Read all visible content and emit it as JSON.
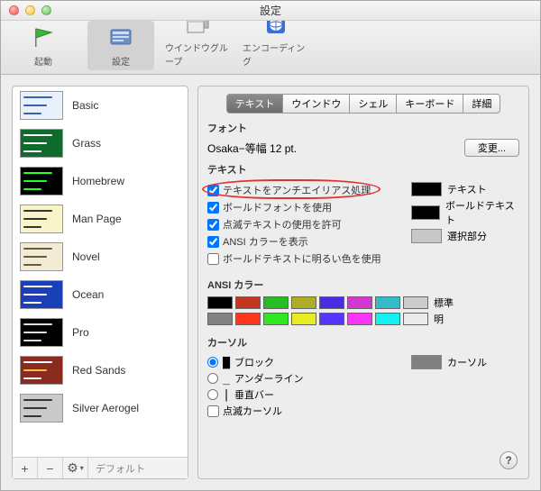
{
  "window": {
    "title": "設定"
  },
  "toolbar": [
    {
      "id": "startup",
      "label": "起動"
    },
    {
      "id": "settings",
      "label": "設定",
      "selected": true
    },
    {
      "id": "windowgroups",
      "label": "ウインドウグループ"
    },
    {
      "id": "encoding",
      "label": "エンコーディング"
    }
  ],
  "sidebar": {
    "profiles": [
      {
        "name": "Basic",
        "bg": "#e8f0fb",
        "bars": [
          "#3963a8",
          "#3963a8",
          "#3963a8"
        ]
      },
      {
        "name": "Grass",
        "bg": "#0e6b2b",
        "bars": [
          "#fff",
          "#fff",
          "#fff"
        ]
      },
      {
        "name": "Homebrew",
        "bg": "#000",
        "bars": [
          "#24ff24",
          "#24ff24",
          "#24ff24"
        ]
      },
      {
        "name": "Man Page",
        "bg": "#f9f3c8",
        "bars": [
          "#333",
          "#333",
          "#333"
        ]
      },
      {
        "name": "Novel",
        "bg": "#f2ebd6",
        "bars": [
          "#6b5a3d",
          "#6b5a3d",
          "#6b5a3d"
        ]
      },
      {
        "name": "Ocean",
        "bg": "#1a3fb6",
        "bars": [
          "#fff",
          "#fff",
          "#fff"
        ]
      },
      {
        "name": "Pro",
        "bg": "#000",
        "bars": [
          "#ddd",
          "#ddd",
          "#ddd"
        ]
      },
      {
        "name": "Red Sands",
        "bg": "#8b2a1f",
        "bars": [
          "#fff",
          "#f5c042",
          "#fff"
        ]
      },
      {
        "name": "Silver Aerogel",
        "bg": "#c9c9c9",
        "bars": [
          "#333",
          "#333",
          "#333"
        ]
      }
    ],
    "footer": {
      "add": "+",
      "remove": "−",
      "gear": "⚙",
      "default": "デフォルト"
    }
  },
  "tabs": [
    {
      "label": "テキスト",
      "selected": true
    },
    {
      "label": "ウインドウ"
    },
    {
      "label": "シェル"
    },
    {
      "label": "キーボード"
    },
    {
      "label": "詳細"
    }
  ],
  "font": {
    "heading": "フォント",
    "value": "Osaka−等幅 12 pt.",
    "change": "変更..."
  },
  "text": {
    "heading": "テキスト",
    "checks": [
      {
        "label": "テキストをアンチエイリアス処理",
        "checked": true,
        "highlight": true
      },
      {
        "label": "ボールドフォントを使用",
        "checked": true
      },
      {
        "label": "点滅テキストの使用を許可",
        "checked": true
      },
      {
        "label": "ANSI カラーを表示",
        "checked": true
      },
      {
        "label": "ボールドテキストに明るい色を使用",
        "checked": false
      }
    ],
    "swatches": [
      {
        "label": "テキスト",
        "color": "#000000"
      },
      {
        "label": "ボールドテキスト",
        "color": "#000000"
      },
      {
        "label": "選択部分",
        "color": "#c8c8c8"
      }
    ]
  },
  "ansi": {
    "heading": "ANSI カラー",
    "normal_label": "標準",
    "bright_label": "明",
    "normal": [
      "#000000",
      "#c23621",
      "#25bc24",
      "#adad27",
      "#492ee1",
      "#d338d3",
      "#33bbc8",
      "#cbcccd"
    ],
    "bright": [
      "#818383",
      "#fc391f",
      "#31e722",
      "#eaec23",
      "#5833ff",
      "#f935f8",
      "#14f0f0",
      "#e9ebeb"
    ]
  },
  "cursor": {
    "heading": "カーソル",
    "shapes": [
      {
        "glyph": "▇",
        "label": "ブロック",
        "selected": true
      },
      {
        "glyph": "_",
        "label": "アンダーライン"
      },
      {
        "glyph": "|",
        "label": "垂直バー"
      }
    ],
    "blink_label": "点滅カーソル",
    "blink_checked": false,
    "swatch_label": "カーソル",
    "swatch_color": "#808080"
  },
  "help": "?"
}
